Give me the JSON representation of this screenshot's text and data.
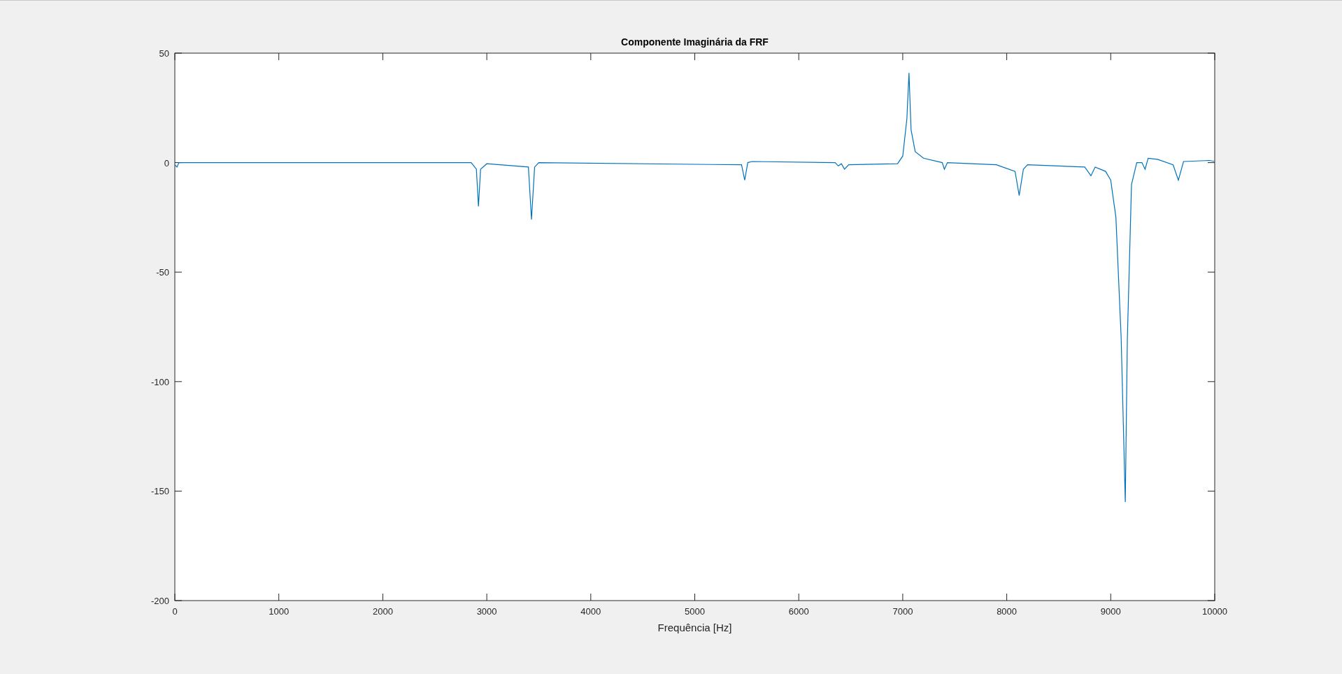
{
  "figure": {
    "chart_data": {
      "type": "line",
      "title": "Componente Imaginária da FRF",
      "xlabel": "Frequência [Hz]",
      "xlim": [
        0,
        10000
      ],
      "ylim": [
        -200,
        50
      ],
      "xticks": [
        0,
        1000,
        2000,
        3000,
        4000,
        5000,
        6000,
        7000,
        8000,
        9000,
        10000
      ],
      "yticks": [
        -200,
        -150,
        -100,
        -50,
        0,
        50
      ],
      "x": [
        0,
        20,
        40,
        100,
        2850,
        2900,
        2920,
        2940,
        3000,
        3400,
        3430,
        3460,
        3500,
        5450,
        5480,
        5510,
        5550,
        6350,
        6380,
        6410,
        6440,
        6480,
        6950,
        7000,
        7040,
        7060,
        7080,
        7120,
        7200,
        7380,
        7400,
        7430,
        7900,
        8080,
        8120,
        8160,
        8200,
        8750,
        8810,
        8850,
        8950,
        9000,
        9050,
        9100,
        9140,
        9160,
        9200,
        9250,
        9300,
        9330,
        9360,
        9450,
        9600,
        9650,
        9700,
        9950,
        10000
      ],
      "series": [
        {
          "color": "#0072bd",
          "values": [
            -1,
            -2,
            0,
            0,
            0,
            -3,
            -20,
            -3,
            -0.5,
            -2,
            -26,
            -2,
            0,
            -1,
            -8,
            0,
            0.5,
            0,
            -1.5,
            -0.5,
            -3,
            -1,
            -0.5,
            3,
            20,
            41,
            15,
            5,
            2,
            0,
            -3,
            0,
            -1,
            -4,
            -15,
            -3,
            -1,
            -2,
            -6,
            -2,
            -4,
            -8,
            -25,
            -80,
            -155,
            -80,
            -10,
            0,
            0,
            -3,
            2,
            1.5,
            -1,
            -8,
            0.5,
            1,
            0.5
          ]
        }
      ]
    }
  }
}
